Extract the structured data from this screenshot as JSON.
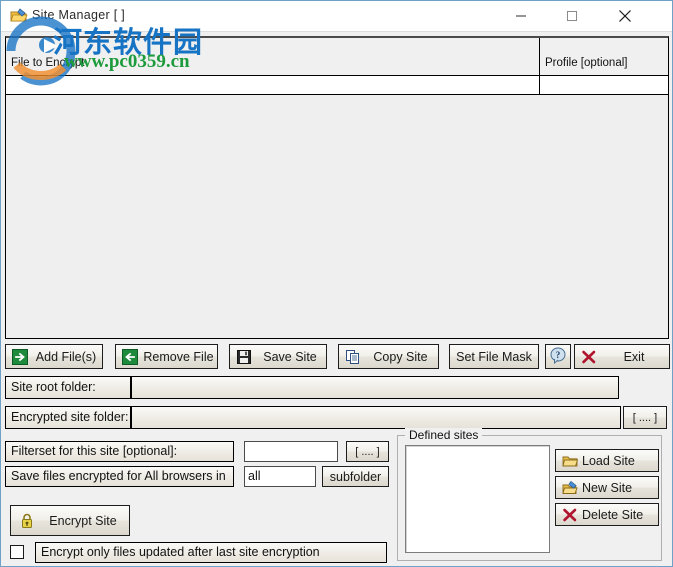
{
  "window": {
    "title": "Site Manager [ ]",
    "icon": "site-manager-icon",
    "minimize_label": "—",
    "maximize_label": "□",
    "close_label": "✕"
  },
  "watermark": {
    "chinese": "河东软件园",
    "url": "www.pc0359.cn",
    "chinese_color": "#1773c4",
    "url_color": "#1e9b3c"
  },
  "file_list": {
    "columns": [
      {
        "label": "File to Encrypt"
      },
      {
        "label": "Profile [optional]"
      }
    ],
    "rows": []
  },
  "toolbar": {
    "add_files": "Add File(s)",
    "remove_file": "Remove File",
    "save_site": "Save Site",
    "copy_site": "Copy Site",
    "set_file_mask": "Set File Mask",
    "help": "?",
    "exit": "Exit"
  },
  "fields": {
    "site_root_label": "Site root folder:",
    "site_root_value": "",
    "encrypted_folder_label": "Encrypted site folder:",
    "encrypted_folder_value": "",
    "encrypted_folder_browse": "[ .... ]",
    "filterset_label": "Filterset for this site [optional]:",
    "filterset_value": "",
    "filterset_browse": "[ .... ]",
    "browsers_label": "Save files encrypted for All browsers in",
    "browsers_value": "all",
    "browsers_suffix": "subfolder"
  },
  "actions": {
    "encrypt_site": "Encrypt Site",
    "encrypt_updated_only": "Encrypt only files updated after last site encryption",
    "encrypt_updated_only_checked": false
  },
  "defined_sites": {
    "group_title": "Defined sites",
    "items": [],
    "load_site": "Load Site",
    "new_site": "New Site",
    "delete_site": "Delete Site"
  },
  "colors": {
    "window_border": "#6fa1c6",
    "list_background": "#efefef",
    "panel_background": "#f0f0f0",
    "green_icon": "#1e8a3c",
    "red_icon": "#b0152e"
  }
}
